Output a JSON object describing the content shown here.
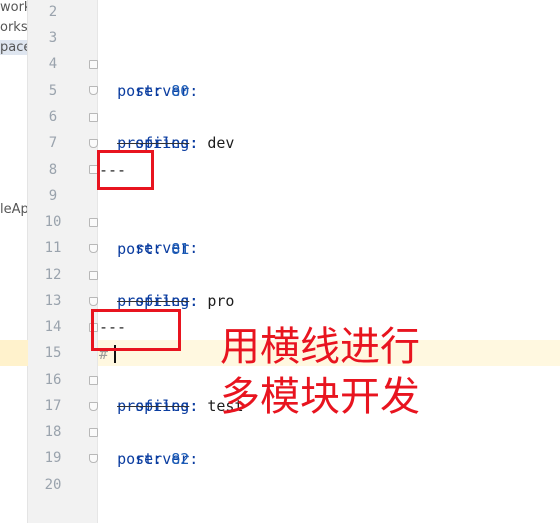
{
  "project_panel": {
    "fragments": [
      "work",
      "orksp",
      "pace",
      "leAp"
    ]
  },
  "gutter": {
    "line_numbers": [
      "2",
      "3",
      "4",
      "5",
      "6",
      "7",
      "8",
      "9",
      "10",
      "11",
      "12",
      "13",
      "14",
      "15",
      "16",
      "17",
      "18",
      "19",
      "20"
    ]
  },
  "code": {
    "l4_key": "server:",
    "l5_key": "port:",
    "l5_val": "80",
    "l6_key": "spring:",
    "l7_key": "profiles",
    "l7_colon": ":",
    "l7_val": " dev",
    "l8": "---",
    "l10_key": "server:",
    "l11_key": "port:",
    "l11_val": "81",
    "l12_key": "spring:",
    "l13_key": "profiles",
    "l13_colon": ":",
    "l13_val": " pro",
    "l14": "---",
    "l15": "#",
    "l16_key": "spring:",
    "l17_key": "profiles",
    "l17_colon": ":",
    "l17_val": " test",
    "l18_key": "server:",
    "l19_key": "port:",
    "l19_val": "82"
  },
  "annotation": {
    "line1": "用横线进行",
    "line2": "多模块开发"
  },
  "colors": {
    "annotation_red": "#e8141f",
    "keyword_blue": "#0b3da0",
    "number_blue": "#1e5fb8",
    "gutter_bg": "#f2f2f2",
    "caret_line_bg": "#fff8e0"
  }
}
